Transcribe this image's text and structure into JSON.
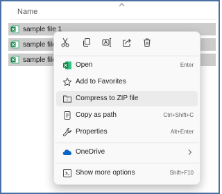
{
  "column_header": "Name",
  "files": [
    {
      "name": "sample file 1"
    },
    {
      "name": "sample file"
    },
    {
      "name": "sample file"
    }
  ],
  "quick_actions": [
    "cut-icon",
    "copy-icon",
    "rename-icon",
    "share-icon",
    "delete-icon"
  ],
  "menu_items": [
    {
      "label": "Open",
      "shortcut": "Enter"
    },
    {
      "label": "Add to Favorites",
      "shortcut": ""
    },
    {
      "label": "Compress to ZIP file",
      "shortcut": ""
    },
    {
      "label": "Copy as path",
      "shortcut": "Ctrl+Shift+C"
    },
    {
      "label": "Properties",
      "shortcut": "Alt+Enter"
    },
    {
      "label": "OneDrive",
      "shortcut": ""
    },
    {
      "label": "Show more options",
      "shortcut": "Shift+F10"
    }
  ],
  "colors": {
    "selection": "#cccccc",
    "highlight": "#ebebeb",
    "menu_bg": "#f9f9f9",
    "accent": "#005fb8",
    "excel_green": "#107c41",
    "frame": "#4a6fa5"
  }
}
